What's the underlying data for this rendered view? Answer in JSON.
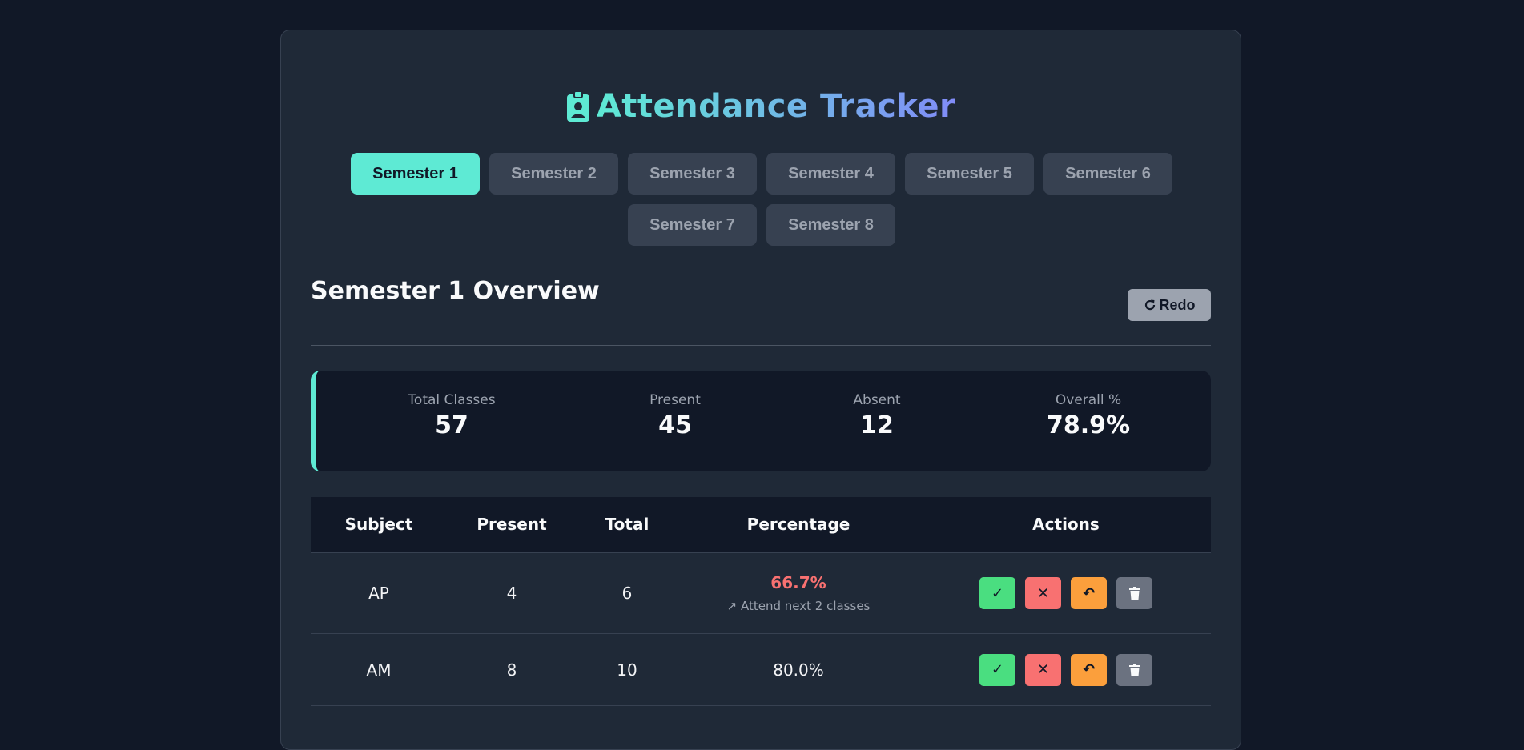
{
  "app": {
    "title": "Attendance Tracker",
    "accent": "#5eead4"
  },
  "tabs": [
    {
      "label": "Semester 1",
      "active": true
    },
    {
      "label": "Semester 2",
      "active": false
    },
    {
      "label": "Semester 3",
      "active": false
    },
    {
      "label": "Semester 4",
      "active": false
    },
    {
      "label": "Semester 5",
      "active": false
    },
    {
      "label": "Semester 6",
      "active": false
    },
    {
      "label": "Semester 7",
      "active": false
    },
    {
      "label": "Semester 8",
      "active": false
    }
  ],
  "overview": {
    "title": "Semester 1 Overview",
    "redo_label": "Redo"
  },
  "stats": [
    {
      "label": "Total Classes",
      "value": "57"
    },
    {
      "label": "Present",
      "value": "45"
    },
    {
      "label": "Absent",
      "value": "12"
    },
    {
      "label": "Overall %",
      "value": "78.9%"
    }
  ],
  "table": {
    "headers": [
      "Subject",
      "Present",
      "Total",
      "Percentage",
      "Actions"
    ],
    "rows": [
      {
        "subject": "AP",
        "present": "4",
        "total": "6",
        "percentage": "66.7%",
        "hint": "Attend next 2 classes",
        "low": true
      },
      {
        "subject": "AM",
        "present": "8",
        "total": "10",
        "percentage": "80.0%",
        "hint": "",
        "low": false
      }
    ],
    "actions": {
      "present": "✓",
      "absent": "✕",
      "undo": "↶",
      "delete": "trash-icon"
    }
  },
  "colors": {
    "present_btn": "#4ade80",
    "absent_btn": "#f87171",
    "undo_btn": "#fb9f3c",
    "delete_btn": "#6b7280",
    "low_percentage": "#f87171"
  }
}
